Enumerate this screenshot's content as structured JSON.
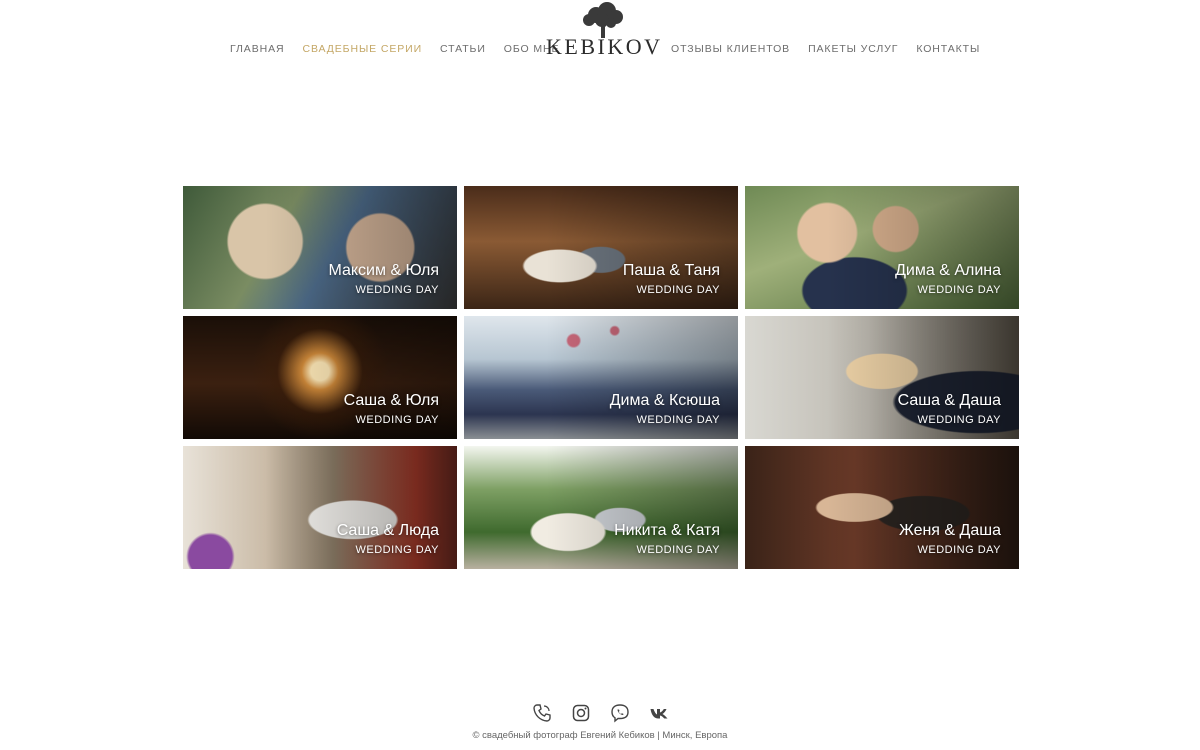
{
  "nav": {
    "left": [
      {
        "label": "ГЛАВНАЯ",
        "active": false
      },
      {
        "label": "СВАДЕБНЫЕ СЕРИИ",
        "active": true
      },
      {
        "label": "СТАТЬИ",
        "active": false
      },
      {
        "label": "ОБО МНЕ",
        "active": false
      }
    ],
    "right": [
      {
        "label": "ОТЗЫВЫ КЛИЕНТОВ"
      },
      {
        "label": "ПАКЕТЫ УСЛУГ"
      },
      {
        "label": "КОНТАКТЫ"
      }
    ]
  },
  "logo": {
    "text": "KEBIKOV",
    "icon": "tree-icon"
  },
  "accent_color": "#c4a766",
  "gallery": [
    {
      "names": "Максим & Юля",
      "subtitle": "WEDDING DAY"
    },
    {
      "names": "Паша & Таня",
      "subtitle": "WEDDING DAY"
    },
    {
      "names": "Дима & Алина",
      "subtitle": "WEDDING DAY"
    },
    {
      "names": "Саша & Юля",
      "subtitle": "WEDDING DAY"
    },
    {
      "names": "Дима & Ксюша",
      "subtitle": "WEDDING DAY"
    },
    {
      "names": "Саша & Даша",
      "subtitle": "WEDDING DAY"
    },
    {
      "names": "Саша & Люда",
      "subtitle": "WEDDING DAY"
    },
    {
      "names": "Никита & Катя",
      "subtitle": "WEDDING DAY"
    },
    {
      "names": "Женя & Даша",
      "subtitle": "WEDDING DAY"
    }
  ],
  "footer": {
    "social_icons": [
      "phone-icon",
      "instagram-icon",
      "viber-icon",
      "vk-icon"
    ],
    "copyright": "© свадебный фотограф Евгений Кебиков | Минск, Европа"
  }
}
